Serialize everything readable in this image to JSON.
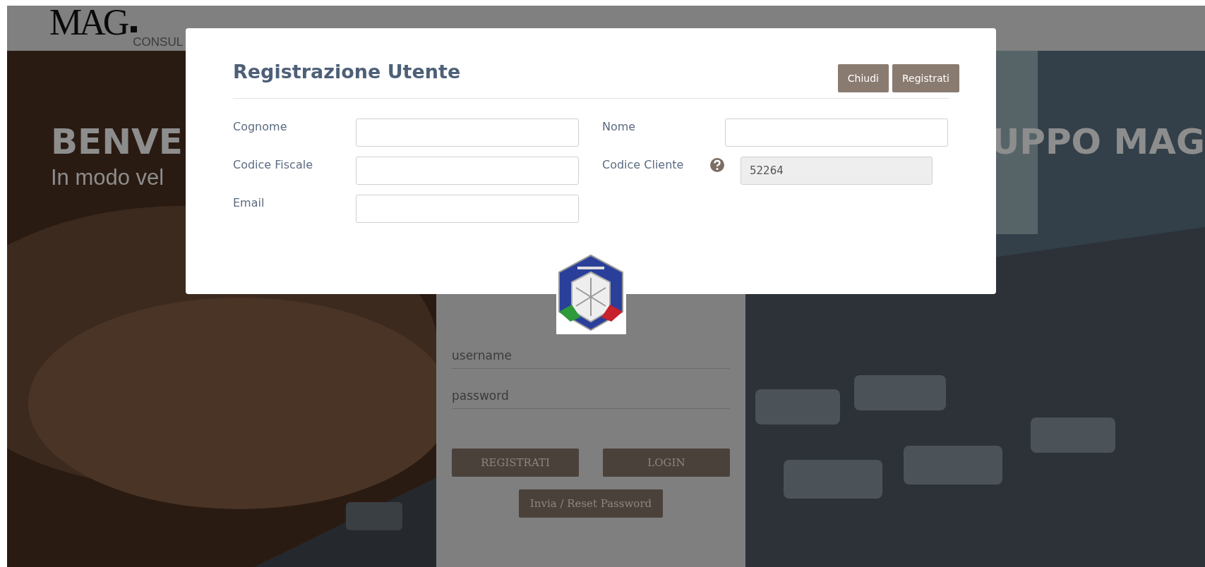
{
  "header": {
    "logo": "MAG",
    "logo_sub": "CONSUL"
  },
  "hero": {
    "headline_left": "BENVE",
    "headline_right": "UPPO MAG",
    "subtitle": "In modo vel"
  },
  "login": {
    "fields": [
      {
        "placeholder": "username"
      },
      {
        "placeholder": "password"
      }
    ],
    "buttons": [
      "REGISTRATI",
      "LOGIN"
    ],
    "reset_button": "Invia / Reset Password"
  },
  "modal": {
    "title": "Registrazione Utente",
    "buttons": [
      "Chiudi",
      "Registrati"
    ],
    "fields": [
      {
        "label": "Cognome",
        "disabled": false,
        "help": false
      },
      {
        "label": "Nome",
        "disabled": false,
        "help": false
      },
      {
        "label": "Codice Fiscale",
        "disabled": false,
        "help": false
      },
      {
        "label": "Codice Cliente",
        "value": "52264",
        "disabled": true,
        "help": true
      },
      {
        "label": "Email",
        "disabled": false,
        "help": false
      }
    ]
  }
}
